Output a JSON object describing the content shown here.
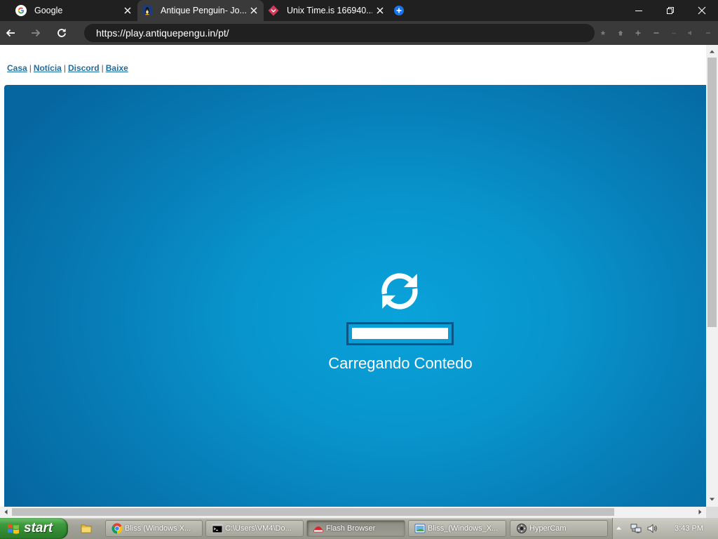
{
  "browser": {
    "tabs": [
      {
        "title": "Google",
        "icon": "google-icon",
        "active": false
      },
      {
        "title": "Antique Penguin- Jo...",
        "icon": "antique-penguin-icon",
        "active": true
      },
      {
        "title": "Unix Time.is 166940...",
        "icon": "time-is-icon",
        "active": false
      }
    ],
    "new_tab_icon": "new-tab-plus-icon",
    "window_controls": [
      "minimize-icon",
      "restore-icon",
      "close-icon"
    ],
    "nav_icons": [
      "back-arrow-icon",
      "forward-arrow-icon",
      "reload-icon"
    ],
    "address": "https://play.antiquepengu.in/pt/",
    "toolbar_icons": [
      "bookmark-star-icon",
      "home-icon",
      "zoom-in-icon",
      "zoom-out-icon",
      "zoom-reset-icon",
      "volume-icon",
      "menu-icon"
    ]
  },
  "page": {
    "nav_links": [
      "Casa",
      "Notícia",
      "Discord",
      "Baixe"
    ],
    "nav_separator": "|",
    "loader": {
      "icon": "refresh-icon",
      "text": "Carregando Contedo",
      "progress": 1.0
    }
  },
  "taskbar": {
    "start_label": "start",
    "quick_launch": [
      "explorer-folder-icon"
    ],
    "tasks": [
      {
        "label": "Bliss (Windows X...",
        "icon": "chrome-icon",
        "active": false
      },
      {
        "label": "C:\\Users\\VM4\\Do...",
        "icon": "cmd-icon",
        "active": false
      },
      {
        "label": "Flash Browser",
        "icon": "flash-browser-icon",
        "active": true
      },
      {
        "label": "Bliss_(Windows_X...",
        "icon": "image-viewer-icon",
        "active": false
      },
      {
        "label": "HyperCam",
        "icon": "hypercam-icon",
        "active": false
      }
    ],
    "tray": {
      "icons": [
        "show-hidden-icons-icon",
        "network-icon",
        "tray-volume-icon"
      ],
      "clock": "3:43 PM"
    }
  },
  "colors": {
    "link": "#1b6ea3",
    "loader_bg_center": "#0aa2da",
    "loader_bg_edge": "#06669f",
    "progress_border": "#0a5787"
  }
}
